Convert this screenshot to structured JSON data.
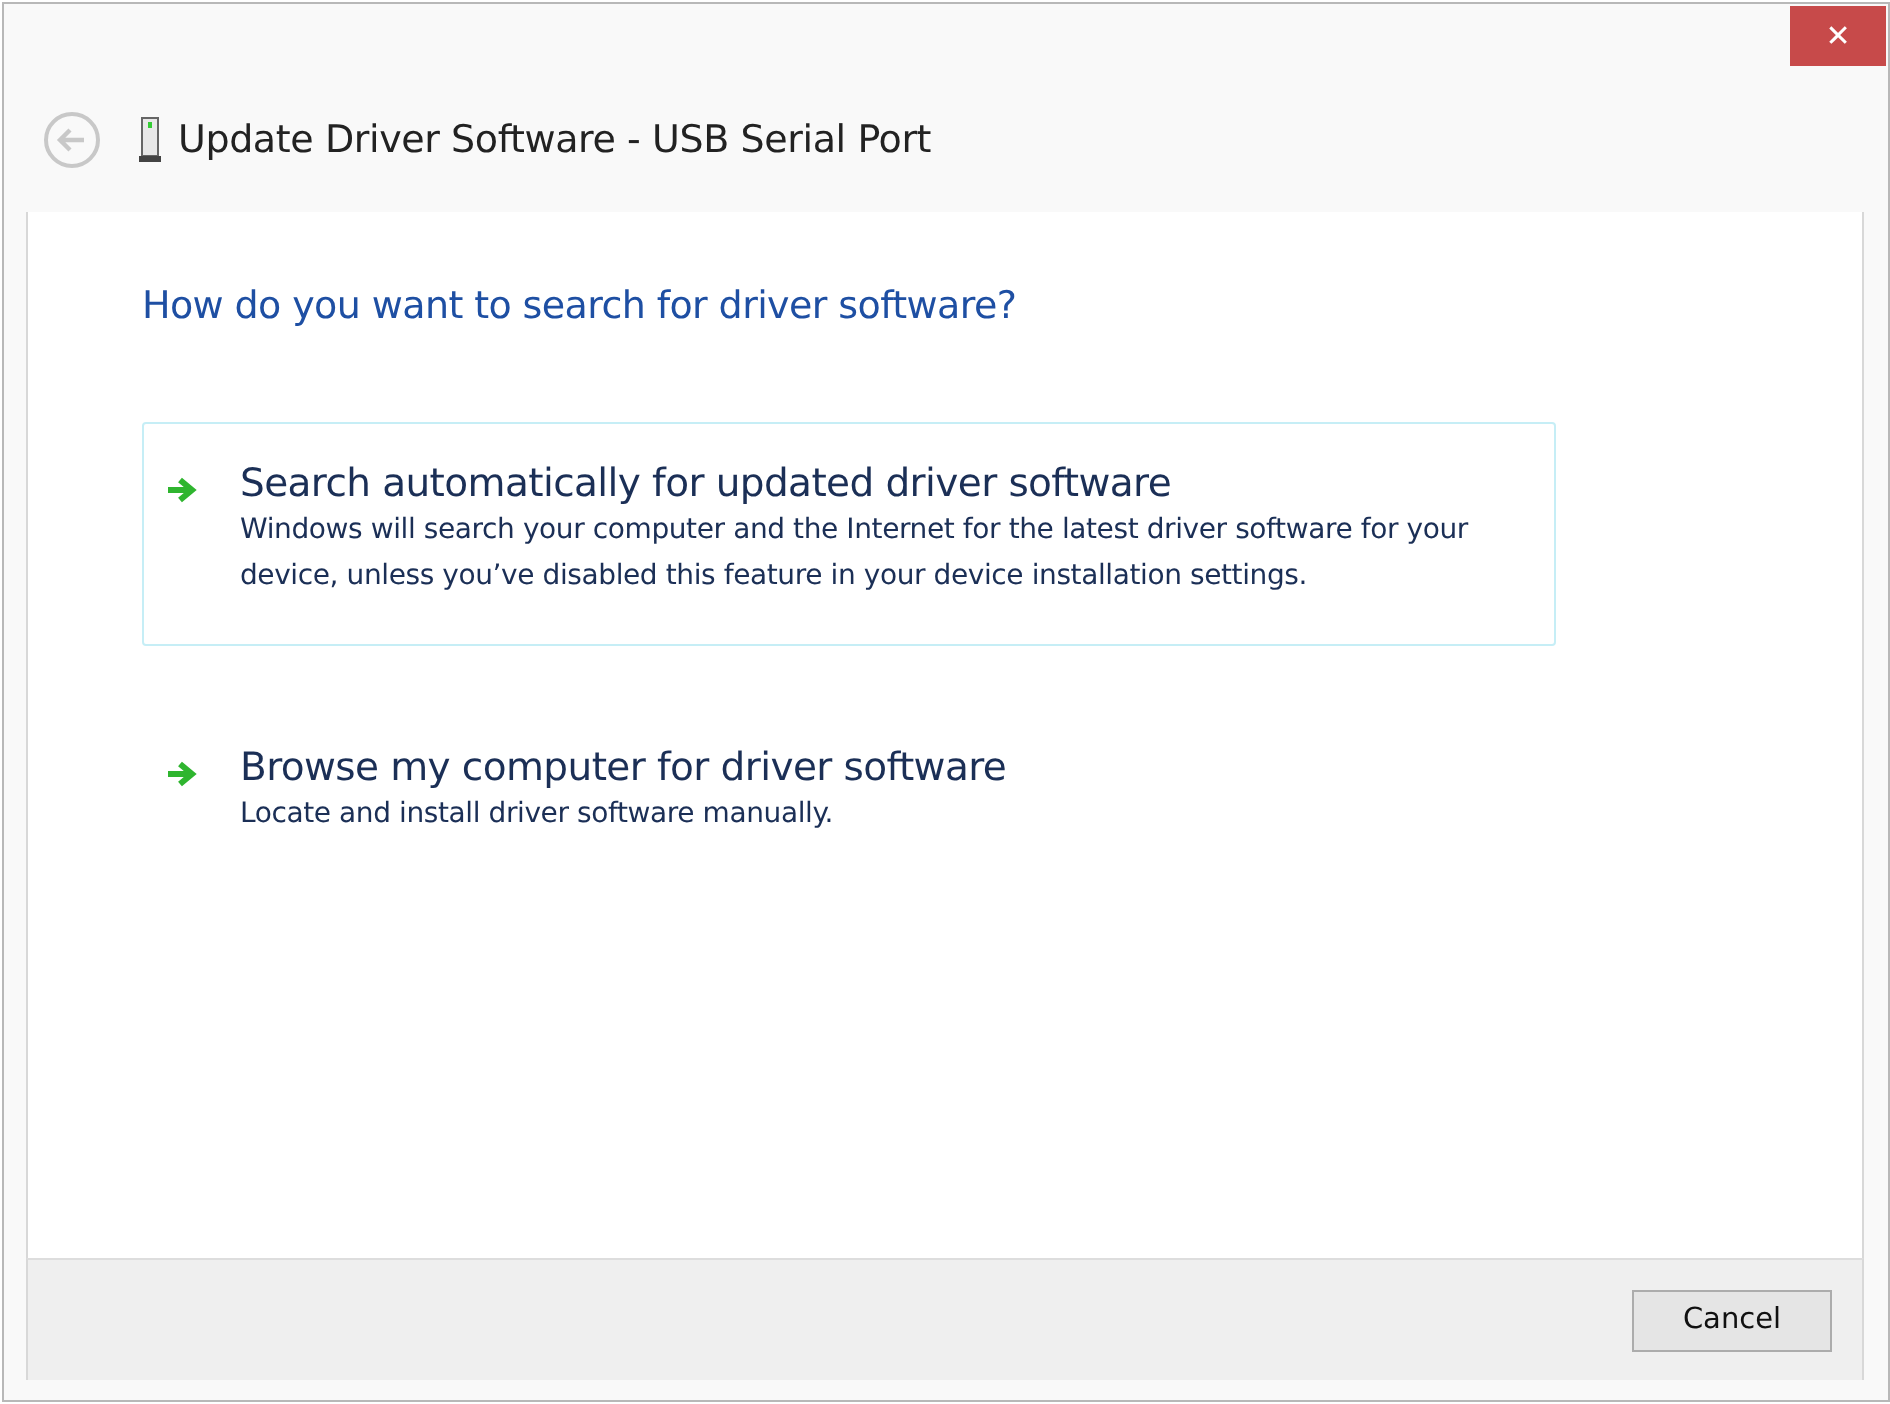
{
  "window": {
    "title": "Update Driver Software - USB Serial Port",
    "close_glyph": "✕"
  },
  "heading": "How do you want to search for driver software?",
  "options": [
    {
      "title": "Search automatically for updated driver software",
      "description": "Windows will search your computer and the Internet for the latest driver software for your device, unless you’ve disabled this feature in your device installation settings.",
      "highlighted": true
    },
    {
      "title": "Browse my computer for driver software",
      "description": "Locate and install driver software manually.",
      "highlighted": false
    }
  ],
  "buttons": [
    "Cancel"
  ]
}
